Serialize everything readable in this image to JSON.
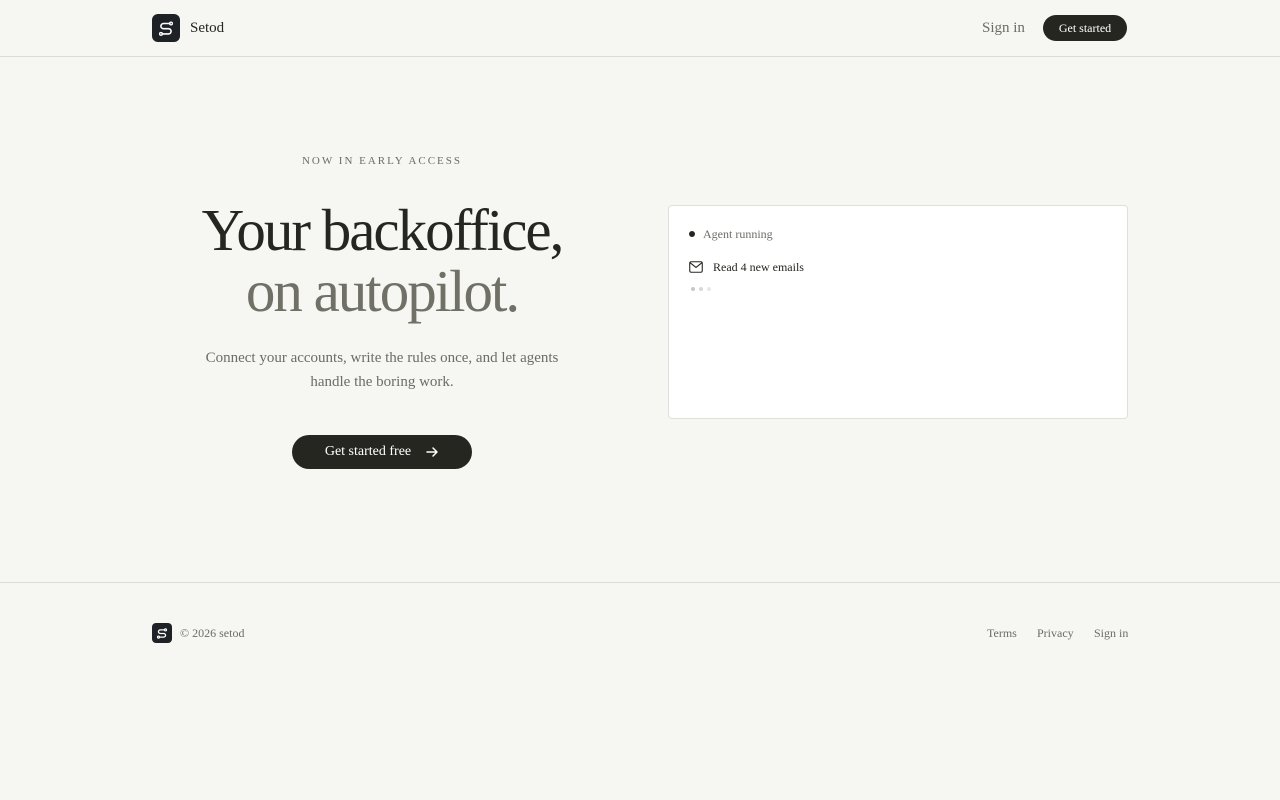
{
  "header": {
    "brand": "Setod",
    "sign_in": "Sign in",
    "cta": "Get started",
    "logo_icon": "setod-logo-icon"
  },
  "hero": {
    "eyebrow": "NOW IN EARLY ACCESS",
    "headline_line1": "Your backoffice,",
    "headline_line2": "on autopilot.",
    "subtext": "Connect your accounts, write the rules once, and let agents handle the boring work.",
    "cta": "Get started free",
    "cta_icon": "arrow-right-icon"
  },
  "agent_panel": {
    "status": "Agent running",
    "task": "Read 4 new emails",
    "task_icon": "mail-icon"
  },
  "footer": {
    "copyright": "© 2026 setod",
    "links": [
      "Terms",
      "Privacy",
      "Sign in"
    ]
  },
  "colors": {
    "background": "#f6f6f2",
    "primary": "#262620",
    "muted": "#6d6d66",
    "logo": "#1e2226"
  }
}
